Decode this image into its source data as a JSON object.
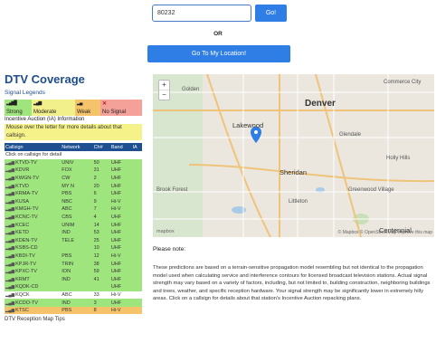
{
  "search": {
    "zip_value": "80232",
    "go_label": "Go!",
    "or_label": "OR",
    "location_button": "Go To My Location!"
  },
  "panel": {
    "title": "DTV Coverage",
    "legend_title": "Signal Legends",
    "legend": {
      "strong": "Strong",
      "moderate": "Moderate",
      "weak": "Weak",
      "no_signal": "No Signal"
    },
    "incentive_info": "Incentive Auction (IA) Information",
    "mouse_note": "Mouse over the letter for more details about that callsign.",
    "columns": [
      "Callsign",
      "Network",
      "Ch#",
      "Band",
      "IA"
    ],
    "click_hint": "Click on callsign for detail",
    "rows": [
      {
        "callsign": "KTVD-TV",
        "network": "UNIV",
        "ch": "50",
        "band": "UHF",
        "ia": "",
        "level": "green"
      },
      {
        "callsign": "KDVR",
        "network": "FOX",
        "ch": "31",
        "band": "UHF",
        "ia": "",
        "level": "green"
      },
      {
        "callsign": "KWGN-TV",
        "network": "CW",
        "ch": "2",
        "band": "UHF",
        "ia": "",
        "level": "green"
      },
      {
        "callsign": "KTVD",
        "network": "MY N",
        "ch": "20",
        "band": "UHF",
        "ia": "",
        "level": "green"
      },
      {
        "callsign": "KRMA-TV",
        "network": "PBS",
        "ch": "6",
        "band": "UHF",
        "ia": "",
        "level": "green"
      },
      {
        "callsign": "KUSA",
        "network": "NBC",
        "ch": "9",
        "band": "Hi-V",
        "ia": "",
        "level": "green"
      },
      {
        "callsign": "KMGH-TV",
        "network": "ABC",
        "ch": "7",
        "band": "Hi-V",
        "ia": "",
        "level": "green"
      },
      {
        "callsign": "KCNC-TV",
        "network": "CBS",
        "ch": "4",
        "band": "UHF",
        "ia": "",
        "level": "green"
      },
      {
        "callsign": "KCEC",
        "network": "UNIM",
        "ch": "14",
        "band": "UHF",
        "ia": "",
        "level": "green"
      },
      {
        "callsign": "KETD",
        "network": "IND",
        "ch": "53",
        "band": "UHF",
        "ia": "",
        "level": "green"
      },
      {
        "callsign": "KDEN-TV",
        "network": "TELE",
        "ch": "25",
        "band": "UHF",
        "ia": "",
        "level": "green"
      },
      {
        "callsign": "KSBS-CD",
        "network": "",
        "ch": "10",
        "band": "UHF",
        "ia": "",
        "level": "green"
      },
      {
        "callsign": "KBDI-TV",
        "network": "PBS",
        "ch": "12",
        "band": "Hi-V",
        "ia": "",
        "level": "green"
      },
      {
        "callsign": "KPJR-TV",
        "network": "TRIN",
        "ch": "38",
        "band": "UHF",
        "ia": "",
        "level": "green"
      },
      {
        "callsign": "KPXC-TV",
        "network": "ION",
        "ch": "59",
        "band": "UHF",
        "ia": "",
        "level": "green"
      },
      {
        "callsign": "KRMT",
        "network": "IND",
        "ch": "41",
        "band": "UHF",
        "ia": "",
        "level": "green"
      },
      {
        "callsign": "KQDK-CD",
        "network": "",
        "ch": "",
        "band": "UHF",
        "ia": "",
        "level": "green"
      },
      {
        "callsign": "KQCK",
        "network": "ABC",
        "ch": "33",
        "band": "Hi-V",
        "ia": "",
        "level": "blank"
      },
      {
        "callsign": "KCDO-TV",
        "network": "IND",
        "ch": "3",
        "band": "UHF",
        "ia": "",
        "level": "green"
      },
      {
        "callsign": "KTSC",
        "network": "PBS",
        "ch": "8",
        "band": "Hi-V",
        "ia": "",
        "level": "orange"
      }
    ],
    "tips_link": "DTV Reception Map Tips"
  },
  "map": {
    "labels": {
      "denver": "Denver",
      "lakewood": "Lakewood",
      "golden": "Golden",
      "sheridan": "Sheridan",
      "littleton": "Littleton",
      "glendale": "Glendale",
      "greenwood": "Greenwood Village",
      "holly": "Holly Hills",
      "centennial": "Centennial",
      "commerce": "Commerce City",
      "brook": "Brook Forest"
    },
    "zoom_in": "+",
    "zoom_out": "−",
    "mapbox": "mapbox",
    "attribution": "© Mapbox © OpenStreetMap  Improve this map"
  },
  "note": {
    "title": "Please note:",
    "body": "These predictions are based on a terrain-sensitive propagation model resembling but not identical to the propagation model used when calculating service and interference contours for licensed broadcast television stations. Actual signal strength may vary based on a variety of factors, including, but not limited to, building construction, neighboring buildings and trees, weather, and specific reception hardware. Your signal strength may be significantly lower in extremely hilly areas. Click on a callsign for details about that station's Incentive Auction repacking plans."
  }
}
